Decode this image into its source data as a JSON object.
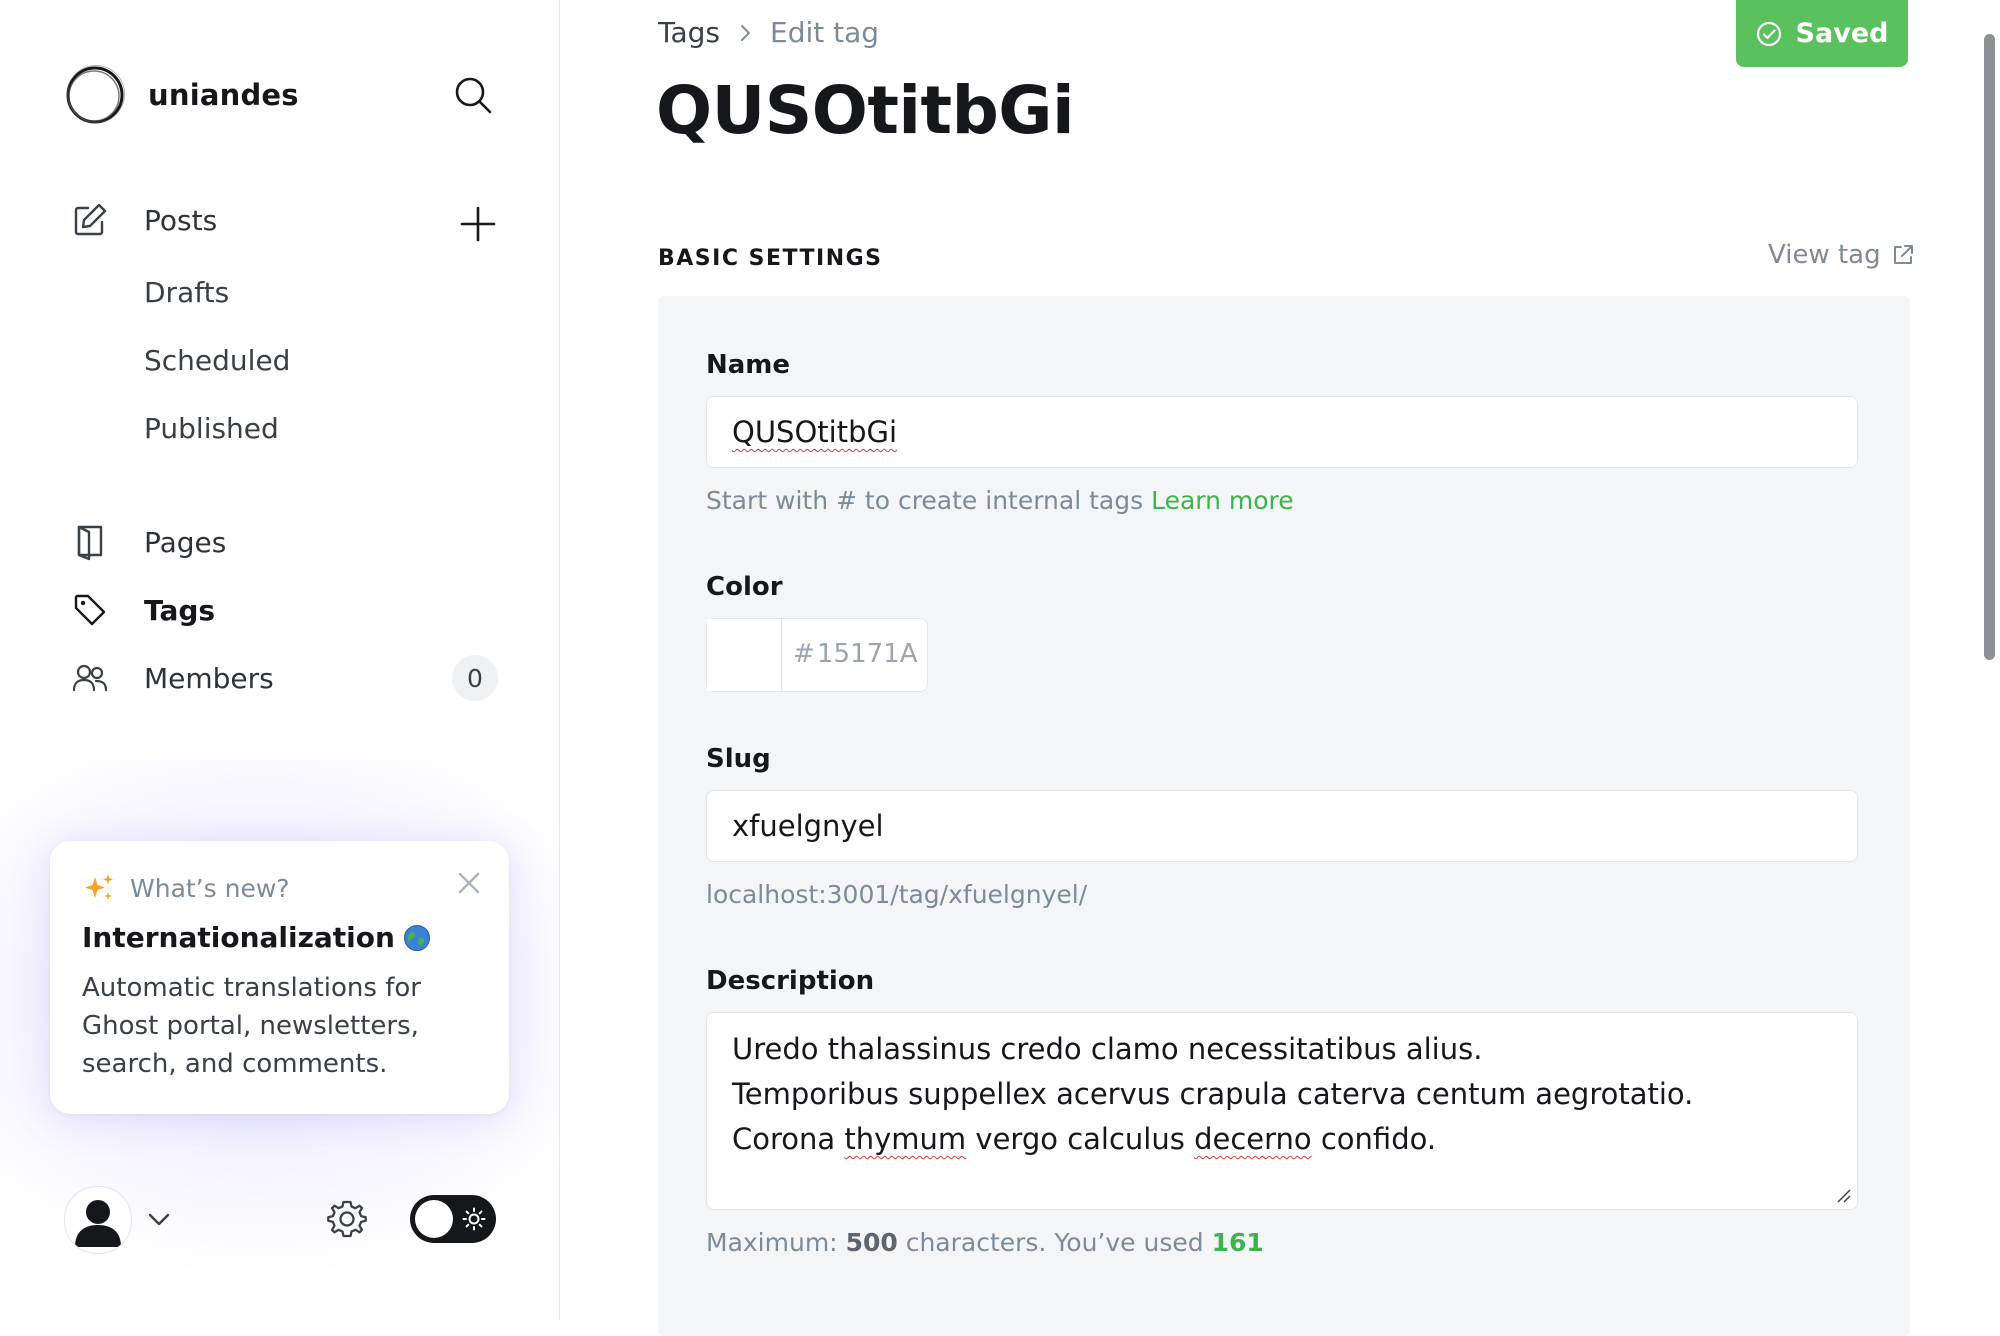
{
  "site": {
    "name": "uniandes"
  },
  "sidebar": {
    "posts": {
      "label": "Posts",
      "sub_items": [
        {
          "label": "Drafts"
        },
        {
          "label": "Scheduled"
        },
        {
          "label": "Published"
        }
      ]
    },
    "items": [
      {
        "label": "Pages",
        "icon": "page-icon"
      },
      {
        "label": "Tags",
        "icon": "tag-icon",
        "active": true
      },
      {
        "label": "Members",
        "icon": "members-icon",
        "count": "0"
      }
    ]
  },
  "whats_new": {
    "label": "What’s new?",
    "title": "Internationalization",
    "text": "Automatic translations for Ghost portal, newsletters, search, and comments."
  },
  "header": {
    "breadcrumb": {
      "root": "Tags",
      "current": "Edit tag"
    },
    "title": "QUSOtitbGi",
    "saved_label": "Saved"
  },
  "section": {
    "title": "BASIC SETTINGS",
    "view_tag": "View tag"
  },
  "form": {
    "name": {
      "label": "Name",
      "value": "QUSOtitbGi",
      "hint": "Start with # to create internal tags",
      "hint_link": "Learn more"
    },
    "color": {
      "label": "Color",
      "hash": "#",
      "placeholder": "15171A",
      "swatch": "#ffffff"
    },
    "slug": {
      "label": "Slug",
      "value": "xfuelgnyel",
      "url": "localhost:3001/tag/xfuelgnyel/"
    },
    "description": {
      "label": "Description",
      "line1": "Uredo thalassinus credo clamo necessitatibus alius.",
      "line2": "Temporibus suppellex acervus crapula caterva centum aegrotatio.",
      "line3_a": "Corona ",
      "line3_b": "thymum",
      "line3_c": " vergo calculus ",
      "line3_d": "decerno",
      "line3_e": " confido.",
      "count_prefix": "Maximum: ",
      "max": "500",
      "count_mid": " characters. You’ve used ",
      "used": "161"
    }
  },
  "colors": {
    "accent_green": "#5ac15e",
    "text_dark": "#15171a",
    "muted": "#7c8b9a"
  }
}
